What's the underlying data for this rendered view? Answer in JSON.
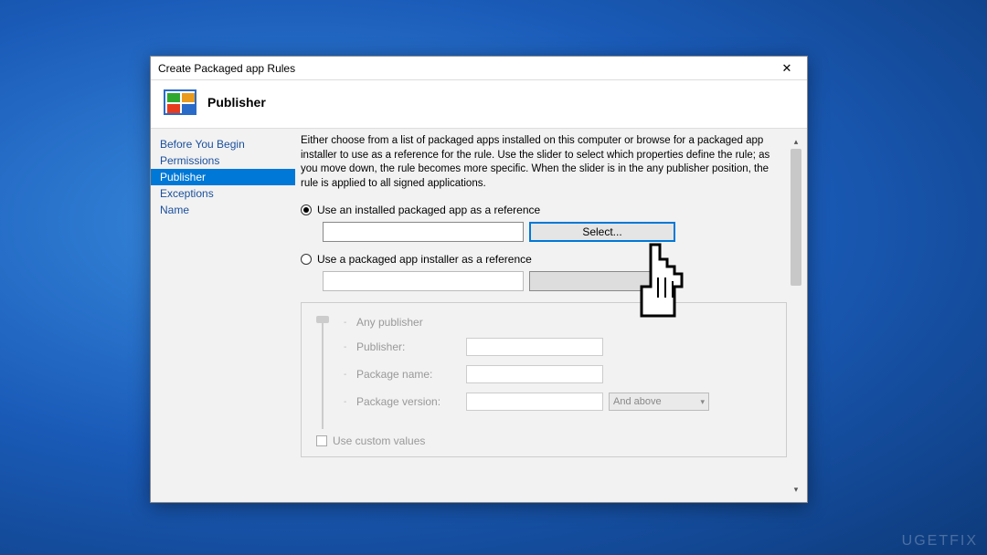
{
  "dialog": {
    "title": "Create Packaged app Rules",
    "close_symbol": "✕"
  },
  "header": {
    "title": "Publisher"
  },
  "sidebar": {
    "items": [
      {
        "label": "Before You Begin"
      },
      {
        "label": "Permissions"
      },
      {
        "label": "Publisher"
      },
      {
        "label": "Exceptions"
      },
      {
        "label": "Name"
      }
    ],
    "selected_index": 2
  },
  "main": {
    "description": "Either choose from a list of packaged apps installed on this computer or browse for a packaged app installer to use as a reference for the rule. Use the slider to select which properties define the rule; as you move down, the rule becomes more specific. When the slider is in the any publisher position, the rule is applied to all signed applications.",
    "radio1": "Use an installed packaged app as a reference",
    "radio2": "Use a packaged app installer as a reference",
    "select_button": "Select...",
    "fields": {
      "any_publisher": "Any publisher",
      "publisher": "Publisher:",
      "package_name": "Package name:",
      "package_version": "Package version:",
      "version_dropdown": "And above"
    },
    "use_custom_values": "Use custom values"
  },
  "watermark": "UGETFIX"
}
